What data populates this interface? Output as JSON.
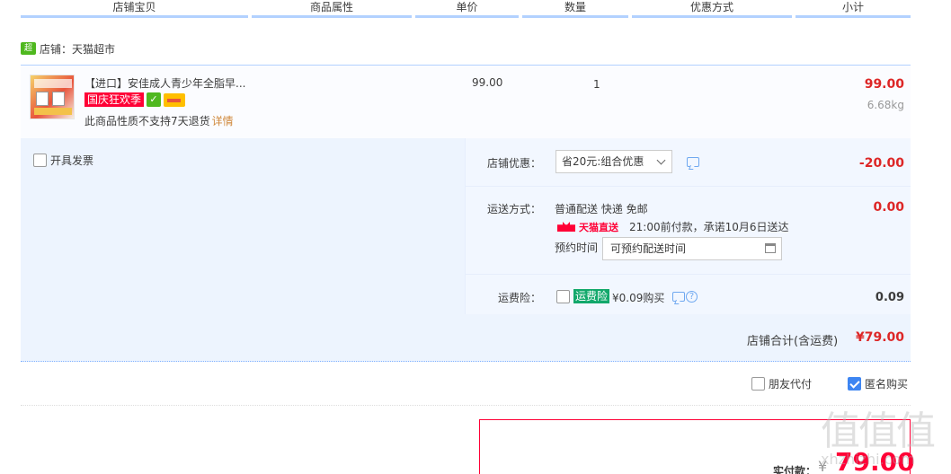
{
  "header": {
    "columns": [
      "店铺宝贝",
      "商品属性",
      "单价",
      "数量",
      "优惠方式",
      "小计"
    ]
  },
  "store": {
    "icon_label": "超市",
    "label": "店铺：天猫超市"
  },
  "item": {
    "title": "【进口】安佳成人青少年全脂早...",
    "promo_tag": "国庆狂欢季",
    "no_return": "此商品性质不支持7天退货",
    "detail_link": "详情",
    "unit_price": "99.00",
    "quantity": "1",
    "subtotal": "99.00",
    "weight": "6.68kg"
  },
  "invoice": {
    "label": "开具发票",
    "checked": false
  },
  "store_discount": {
    "label": "店铺优惠：",
    "selected": "省20元:组合优惠",
    "value": "-20.00"
  },
  "shipping": {
    "label": "运送方式：",
    "method": "普通配送 快递 免邮",
    "tmall_tag": "天猫直送",
    "promise": "21:00前付款，承诺10月6日送达",
    "schedule_label": "预约时间",
    "schedule_value": "可预约配送时间",
    "value": "0.00"
  },
  "insurance": {
    "label": "运费险：",
    "tag": "运费险",
    "price_text": "¥0.09购买",
    "value": "0.09",
    "checked": false
  },
  "store_total": {
    "label": "店铺合计(含运费)",
    "value": "¥79.00"
  },
  "bottom_options": {
    "friend_pay": "朋友代付",
    "friend_pay_checked": false,
    "anonymous": "匿名购买",
    "anonymous_checked": true
  },
  "payment": {
    "label": "实付款：",
    "currency": "¥",
    "amount": "79.00"
  },
  "watermark": {
    "chars": "值值值",
    "url": "xhzhizhi.com"
  },
  "colors": {
    "accent_red": "#dd2727",
    "tmall_red": "#ff0036",
    "header_border": "#b2d1ff",
    "option_bg": "#edf4fe"
  }
}
